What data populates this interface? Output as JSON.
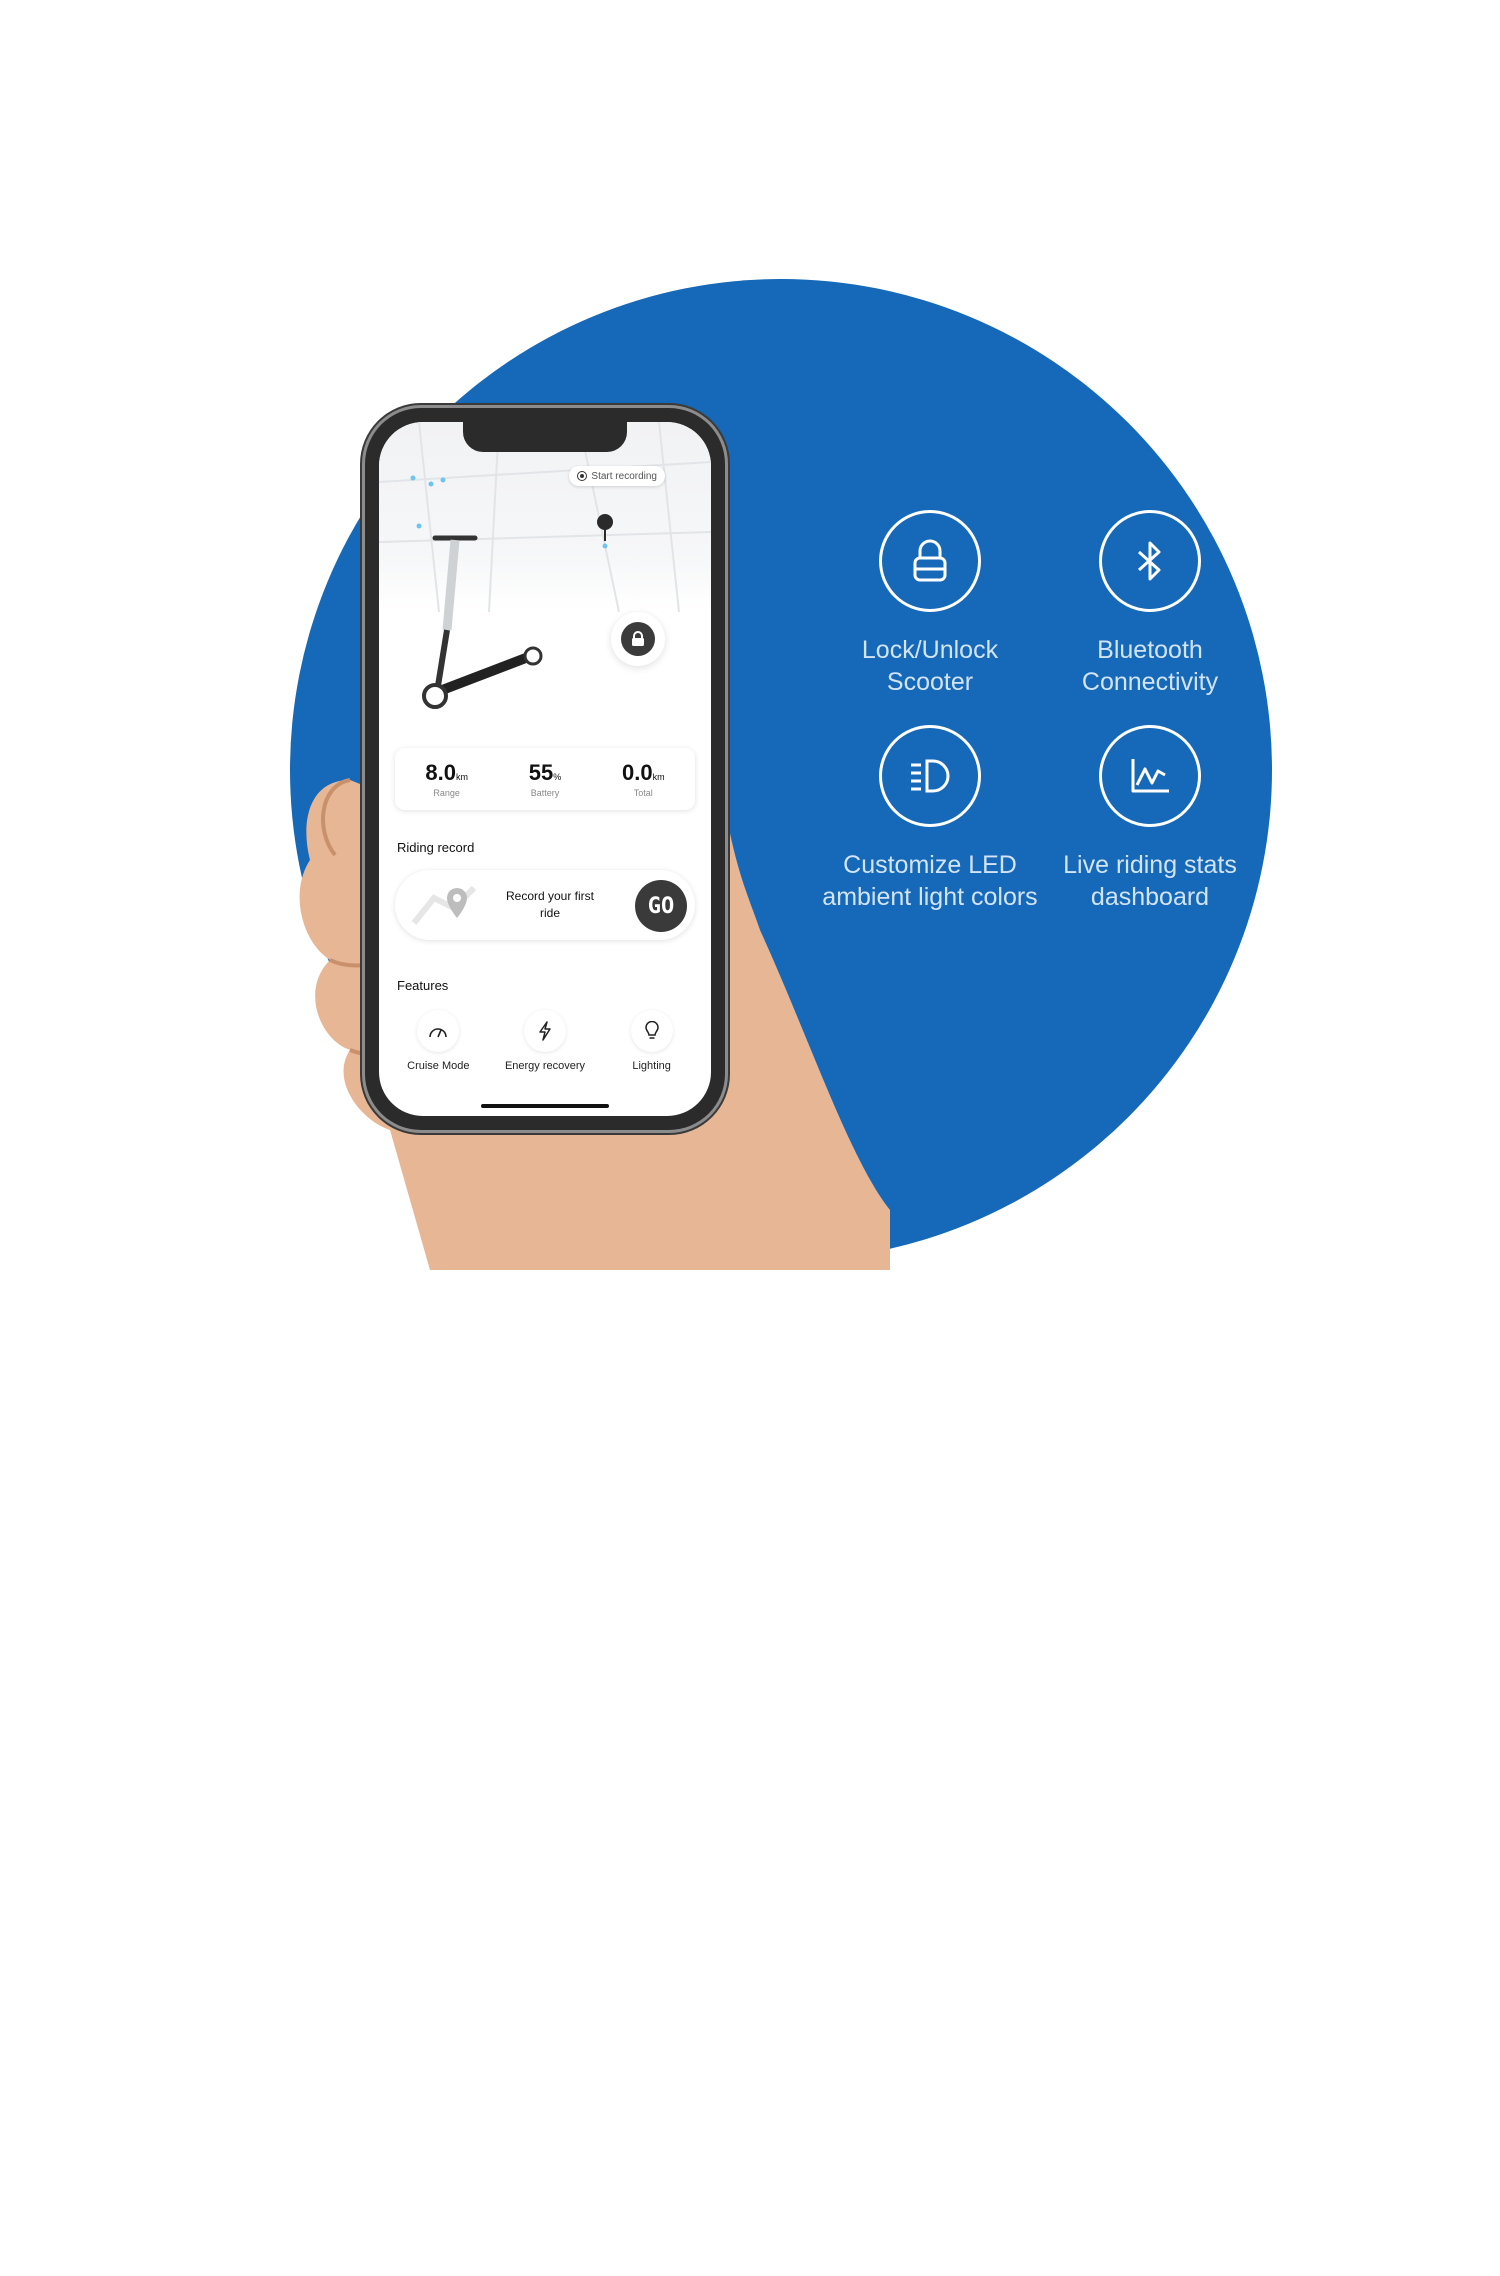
{
  "colors": {
    "circle": "#1569b8",
    "feature_text": "#d2e4f6",
    "icon_stroke": "#ffffff"
  },
  "features": [
    {
      "label": "Lock/Unlock Scooter",
      "icon": "lock-icon"
    },
    {
      "label": "Bluetooth Connectivity",
      "icon": "bluetooth-icon"
    },
    {
      "label": "Customize LED ambient light colors",
      "icon": "headlight-icon"
    },
    {
      "label": "Live riding stats dashboard",
      "icon": "chart-icon"
    }
  ],
  "app": {
    "start_recording": "Start recording",
    "stats": [
      {
        "value": "8.0",
        "unit": "km",
        "label": "Range"
      },
      {
        "value": "55",
        "unit": "%",
        "label": "Battery"
      },
      {
        "value": "0.0",
        "unit": "km",
        "label": "Total"
      }
    ],
    "riding_record_title": "Riding record",
    "record_prompt": "Record your first ride",
    "go_label": "GO",
    "features_title": "Features",
    "feature_items": [
      {
        "label": "Cruise Mode",
        "icon": "speedometer-icon"
      },
      {
        "label": "Energy recovery",
        "icon": "lightning-icon"
      },
      {
        "label": "Lighting",
        "icon": "bulb-icon"
      }
    ]
  }
}
